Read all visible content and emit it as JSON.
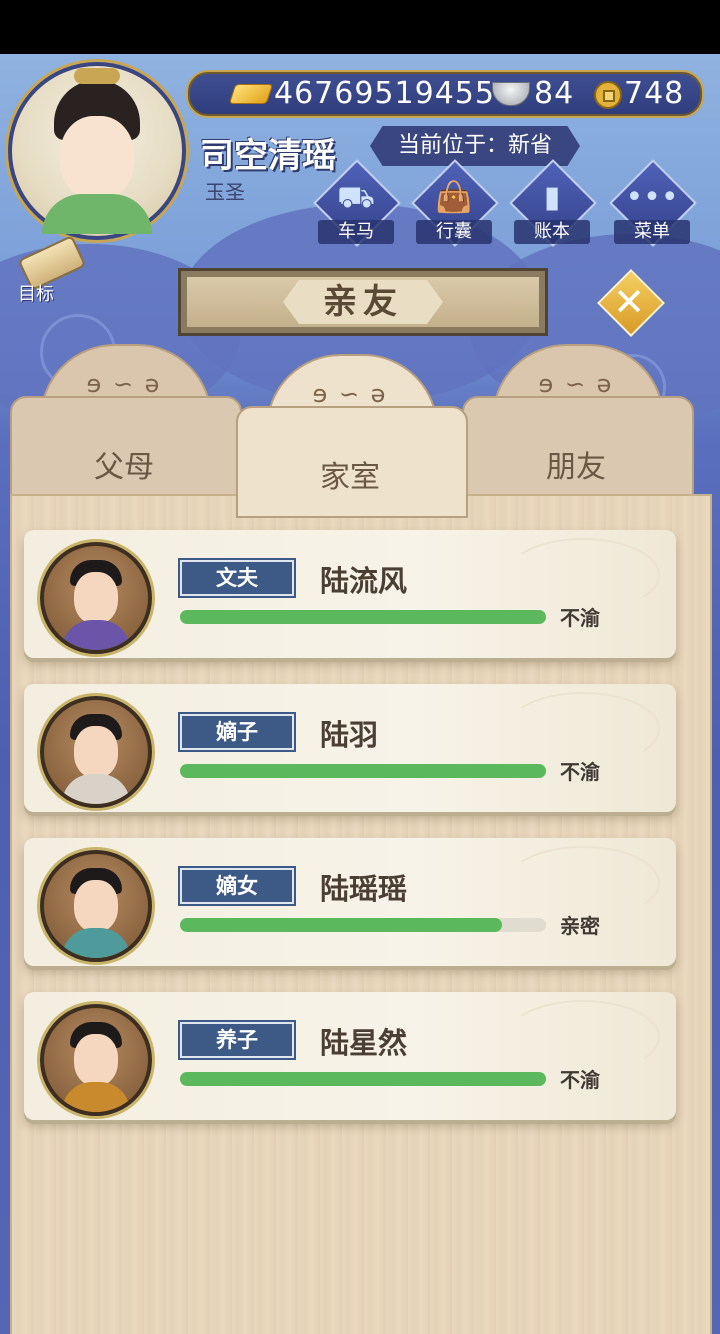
{
  "currency": {
    "gold": "46769519455",
    "silver": "84",
    "copper": "748"
  },
  "player": {
    "name": "司空清瑶",
    "title": "玉圣",
    "location": "当前位于：新省"
  },
  "nav": [
    {
      "label": "车马",
      "icon": "carriage-icon"
    },
    {
      "label": "行囊",
      "icon": "bag-icon"
    },
    {
      "label": "账本",
      "icon": "ledger-icon"
    },
    {
      "label": "菜单",
      "icon": "menu-dots-icon"
    }
  ],
  "goal_label": "目标",
  "header": {
    "title": "亲友"
  },
  "tabs": [
    {
      "label": "父母",
      "active": false
    },
    {
      "label": "家室",
      "active": true
    },
    {
      "label": "朋友",
      "active": false
    }
  ],
  "relatives": [
    {
      "role": "文夫",
      "name": "陆流风",
      "status": "不渝",
      "affinity": 1.0,
      "robe": "#6b55a8"
    },
    {
      "role": "嫡子",
      "name": "陆羽",
      "status": "不渝",
      "affinity": 1.0,
      "robe": "#d9d2c8"
    },
    {
      "role": "嫡女",
      "name": "陆瑶瑶",
      "status": "亲密",
      "affinity": 0.88,
      "robe": "#4f9a9a"
    },
    {
      "role": "养子",
      "name": "陆星然",
      "status": "不渝",
      "affinity": 1.0,
      "robe": "#c98a2e"
    }
  ]
}
